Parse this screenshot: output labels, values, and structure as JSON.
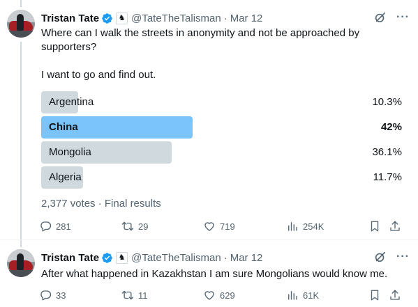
{
  "tweets": [
    {
      "author_name": "Tristan Tate",
      "handle": "@TateTheTalisman",
      "separator": "·",
      "date": "Mar 12",
      "text_lines": [
        "Where can I walk the streets in anonymity and not be approached by supporters?",
        "I want to go and find out."
      ],
      "poll": {
        "options": [
          {
            "label": "Argentina",
            "percent_text": "10.3%",
            "percent": 10.3,
            "winner": false
          },
          {
            "label": "China",
            "percent_text": "42%",
            "percent": 42,
            "winner": true
          },
          {
            "label": "Mongolia",
            "percent_text": "36.1%",
            "percent": 36.1,
            "winner": false
          },
          {
            "label": "Algeria",
            "percent_text": "11.7%",
            "percent": 11.7,
            "winner": false
          }
        ],
        "meta": "2,377 votes · Final results"
      },
      "stats": {
        "replies": "281",
        "reposts": "29",
        "likes": "719",
        "views": "254K"
      }
    },
    {
      "author_name": "Tristan Tate",
      "handle": "@TateTheTalisman",
      "separator": "·",
      "date": "Mar 12",
      "text_lines": [
        "After what happened in Kazakhstan I am sure Mongolians would know me."
      ],
      "stats": {
        "replies": "33",
        "reposts": "11",
        "likes": "629",
        "views": "61K"
      }
    }
  ],
  "icons": {
    "verified": "verified-badge-icon",
    "affiliate": "affiliate-chess-icon",
    "grok": "grok-icon",
    "more": "more-icon",
    "reply": "reply-icon",
    "repost": "repost-icon",
    "like": "like-icon",
    "views": "views-icon",
    "bookmark": "bookmark-icon",
    "share": "share-icon"
  },
  "colors": {
    "verified_blue": "#1d9bf0",
    "poll_bar": "#cfd9de",
    "poll_winner": "#7ac3fb",
    "secondary_text": "#536471"
  }
}
